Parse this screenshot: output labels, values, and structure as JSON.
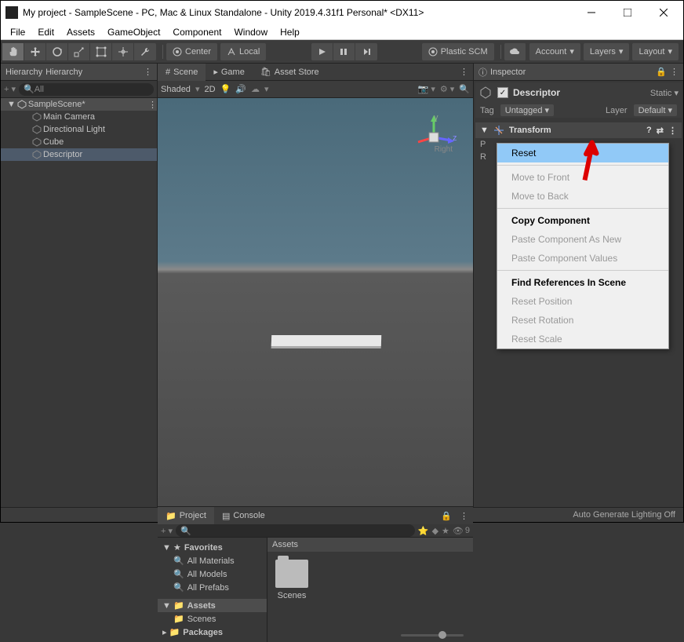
{
  "window": {
    "title": "My project - SampleScene - PC, Mac & Linux Standalone - Unity 2019.4.31f1 Personal* <DX11>"
  },
  "menus": [
    "File",
    "Edit",
    "Assets",
    "GameObject",
    "Component",
    "Window",
    "Help"
  ],
  "toolbar": {
    "center": "Center",
    "local": "Local",
    "plastic": "Plastic SCM",
    "account": "Account",
    "layers": "Layers",
    "layout": "Layout"
  },
  "hierarchy": {
    "title": "Hierarchy",
    "search": "All",
    "scene": "SampleScene*",
    "items": [
      "Main Camera",
      "Directional Light",
      "Cube",
      "Descriptor"
    ]
  },
  "sceneTabs": {
    "scene": "Scene",
    "game": "Game",
    "store": "Asset Store"
  },
  "sceneBar": {
    "shaded": "Shaded",
    "mode": "2D"
  },
  "gizmo": {
    "right": "Right"
  },
  "inspector": {
    "title": "Inspector",
    "obj": "Descriptor",
    "static": "Static",
    "tagLabel": "Tag",
    "tag": "Untagged",
    "layerLabel": "Layer",
    "layer": "Default",
    "transform": "Transform",
    "rows": {
      "p": "P",
      "r": "R"
    }
  },
  "contextMenu": {
    "reset": "Reset",
    "moveFront": "Move to Front",
    "moveBack": "Move to Back",
    "copy": "Copy Component",
    "pasteNew": "Paste Component As New",
    "pasteVal": "Paste Component Values",
    "findRef": "Find References In Scene",
    "resetPos": "Reset Position",
    "resetRot": "Reset Rotation",
    "resetScale": "Reset Scale"
  },
  "project": {
    "project": "Project",
    "console": "Console",
    "fav": "Favorites",
    "allMat": "All Materials",
    "allMod": "All Models",
    "allPre": "All Prefabs",
    "assets": "Assets",
    "scenes": "Scenes",
    "packages": "Packages",
    "path": "Assets",
    "folderScenes": "Scenes"
  },
  "status": "Auto Generate Lighting Off",
  "visibilityCount": "9"
}
